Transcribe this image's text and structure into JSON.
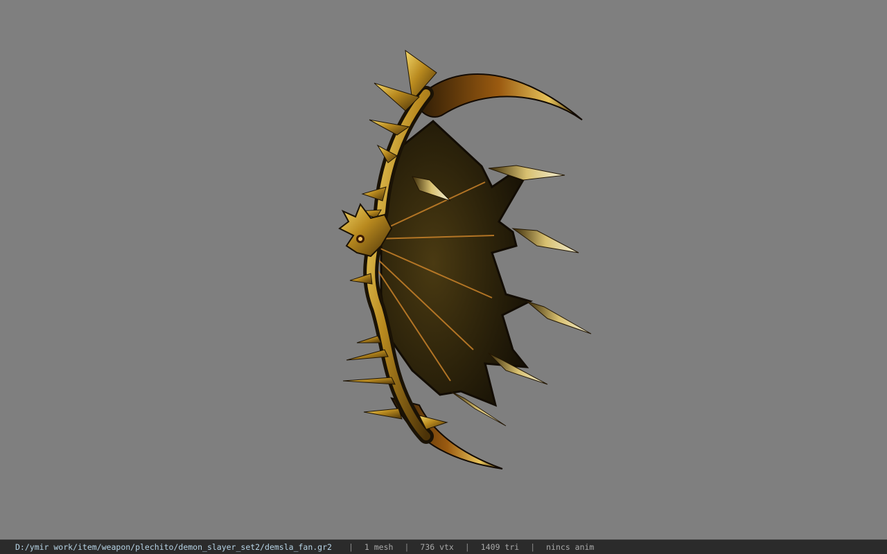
{
  "viewer": {
    "background_color": "#7f7f7f",
    "model_name": "demon slayer fan model"
  },
  "statusbar": {
    "path": "D:/ymir work/item/weapon/plechito/demon_slayer_set2/demsla_fan.gr2",
    "mesh": "1 mesh",
    "vertices": "736 vtx",
    "triangles": "1409 tri",
    "animation": "nincs anim"
  }
}
